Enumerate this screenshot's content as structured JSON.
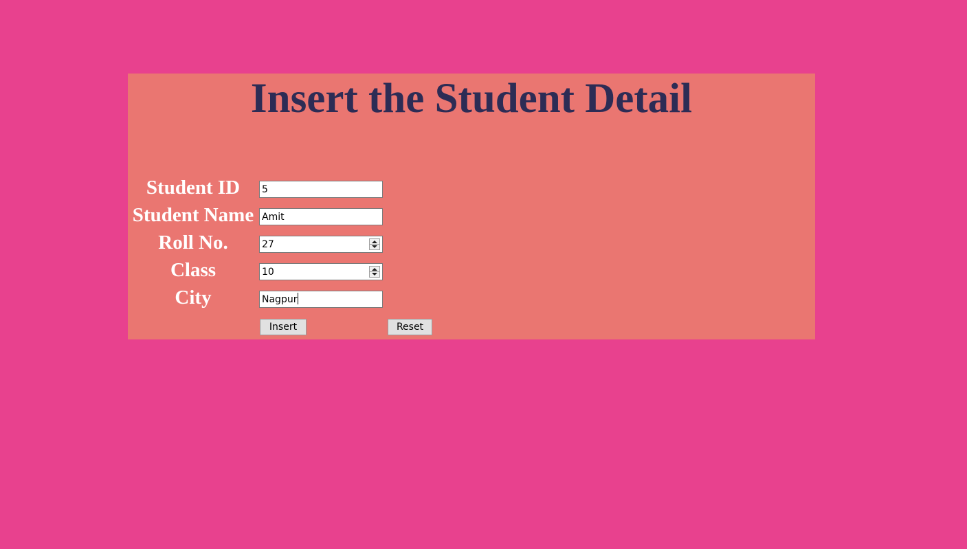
{
  "page": {
    "title": "Insert the Student Detail",
    "background_color": "#e8418e",
    "panel_color": "#ea7671",
    "title_color": "#2d2c55"
  },
  "form": {
    "fields": [
      {
        "label": "Student ID",
        "value": "5",
        "type": "text"
      },
      {
        "label": "Student Name",
        "value": "Amit",
        "type": "text"
      },
      {
        "label": "Roll No.",
        "value": "27",
        "type": "number"
      },
      {
        "label": "Class",
        "value": "10",
        "type": "number"
      },
      {
        "label": "City",
        "value": "Nagpur",
        "type": "text"
      }
    ],
    "insert_label": "Insert",
    "reset_label": "Reset"
  }
}
